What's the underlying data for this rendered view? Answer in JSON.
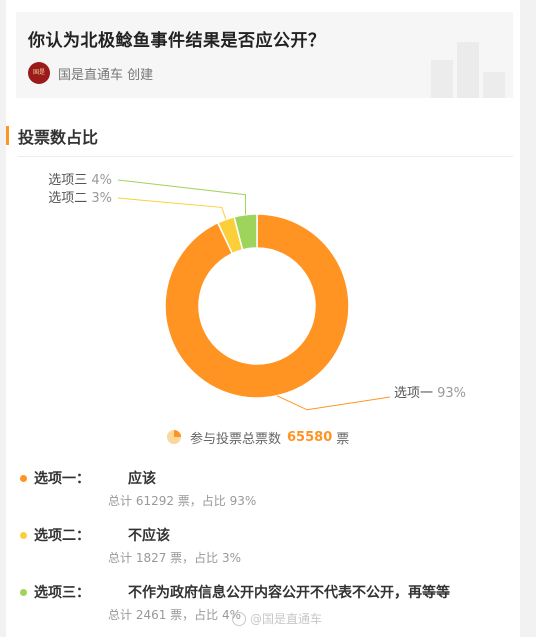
{
  "header": {
    "question": "你认为北极鲶鱼事件结果是否应公开？",
    "creator": "国是直通车 创建"
  },
  "section": {
    "title": "投票数占比"
  },
  "chart_data": {
    "type": "pie",
    "title": "投票数占比",
    "categories": [
      "选项一",
      "选项二",
      "选项三"
    ],
    "values": [
      93,
      3,
      4
    ],
    "labels": [
      "选项一 93%",
      "选项二 3%",
      "选项三 4%"
    ],
    "colors": [
      "#ff9422",
      "#fbcf3a",
      "#9fd45c"
    ]
  },
  "total": {
    "prefix": "参与投票总票数",
    "count": "65580",
    "unit": "票"
  },
  "options": [
    {
      "name": "选项一：",
      "label": "应该",
      "stats": "总计 61292 票，占比 93%",
      "color": "#ff9422"
    },
    {
      "name": "选项二：",
      "label": "不应该",
      "stats": "总计 1827 票，占比 3%",
      "color": "#fbcf3a"
    },
    {
      "name": "选项三：",
      "label": "不作为政府信息公开内容公开不代表不公开，再等等",
      "stats": "总计 2461 票，占比 4%",
      "color": "#9fd45c"
    }
  ],
  "watermark": "@国是直通车"
}
